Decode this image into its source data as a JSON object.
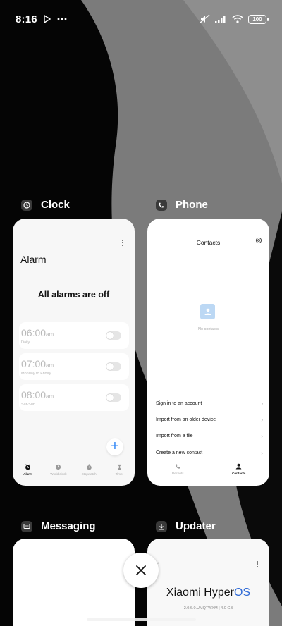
{
  "status_bar": {
    "time": "8:16",
    "battery": "100",
    "icons": [
      "play-store-icon",
      "more-dots-icon",
      "mute-icon",
      "signal-icon",
      "wifi-icon",
      "battery-icon"
    ]
  },
  "apps": {
    "clock": {
      "name": "Clock"
    },
    "phone": {
      "name": "Phone"
    },
    "messaging": {
      "name": "Messaging"
    },
    "updater": {
      "name": "Updater"
    }
  },
  "clock_card": {
    "title": "Alarm",
    "empty_state": "All alarms are off",
    "alarms": [
      {
        "time": "06:00",
        "ampm": "am",
        "repeat": "Daily",
        "enabled": false
      },
      {
        "time": "07:00",
        "ampm": "am",
        "repeat": "Monday to Friday",
        "enabled": false
      },
      {
        "time": "08:00",
        "ampm": "am",
        "repeat": "Sat-Sun",
        "enabled": false
      }
    ],
    "fab": "+",
    "tabs": [
      {
        "label": "Alarm",
        "active": true
      },
      {
        "label": "World clock",
        "active": false
      },
      {
        "label": "Stopwatch",
        "active": false
      },
      {
        "label": "Timer",
        "active": false
      }
    ]
  },
  "phone_card": {
    "title": "Contacts",
    "empty_state": "No contacts",
    "options": [
      "Sign in to an account",
      "Import from an older device",
      "Import from a file",
      "Create a new contact"
    ],
    "tabs": [
      {
        "label": "Recents",
        "active": false
      },
      {
        "label": "Contacts",
        "active": true
      }
    ]
  },
  "updater_card": {
    "brand_prefix": "Xiaomi Hyper",
    "brand_suffix": "OS",
    "version": "2.0.6.0.UMQTWXM | 4.0 GB"
  },
  "colors": {
    "accent_blue": "#2f86f6",
    "os_blue": "#2f6ad6"
  }
}
